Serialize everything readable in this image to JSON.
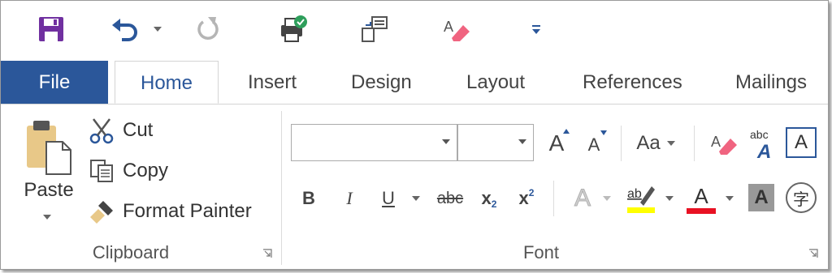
{
  "tabs": {
    "file": "File",
    "home": "Home",
    "insert": "Insert",
    "design": "Design",
    "layout": "Layout",
    "references": "References",
    "mailings": "Mailings"
  },
  "clipboard": {
    "paste_label": "Paste",
    "cut_label": "Cut",
    "copy_label": "Copy",
    "format_painter_label": "Format Painter",
    "group_label": "Clipboard"
  },
  "font": {
    "group_label": "Font",
    "font_name_value": "",
    "font_size_value": "",
    "grow_font_glyph": "A",
    "shrink_font_glyph": "A",
    "change_case_glyph": "Aa",
    "bold_glyph": "B",
    "italic_glyph": "I",
    "underline_glyph": "U",
    "strikethrough_glyph": "abc",
    "subscript_glyph": "x",
    "superscript_glyph": "x",
    "text_effects_glyph": "A",
    "font_color_glyph": "A",
    "shading_glyph": "A",
    "enclose_glyph": "字",
    "border_glyph": "A",
    "abc_glyph": "abc"
  },
  "colors": {
    "file_tab": "#2b579a",
    "accent": "#2b579a",
    "highlight": "#ffff00",
    "font_color": "#e81123",
    "save_icon": "#7030a0"
  }
}
